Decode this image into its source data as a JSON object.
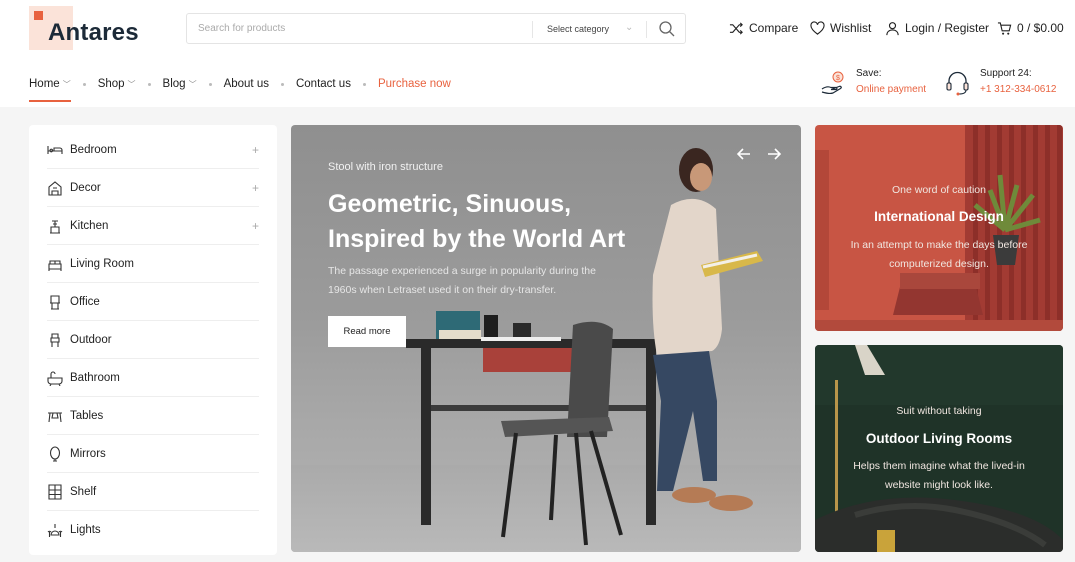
{
  "brand": {
    "name": "Antares",
    "accent": "#e8623f"
  },
  "search": {
    "placeholder": "Search for products",
    "category": "Select category"
  },
  "header_actions": {
    "compare": "Compare",
    "wishlist": "Wishlist",
    "login": "Login / Register",
    "cart": "0 / $0.00"
  },
  "nav": {
    "home": "Home",
    "shop": "Shop",
    "blog": "Blog",
    "about": "About us",
    "contact": "Contact us",
    "purchase": "Purchase now"
  },
  "info": {
    "save_label": "Save:",
    "save_value": "Online payment",
    "support_label": "Support 24:",
    "support_value": "+1 312-334-0612"
  },
  "sidebar": {
    "items": [
      {
        "label": "Bedroom",
        "icon": "bed-icon",
        "expandable": true
      },
      {
        "label": "Decor",
        "icon": "decor-icon",
        "expandable": true
      },
      {
        "label": "Kitchen",
        "icon": "kitchen-icon",
        "expandable": true
      },
      {
        "label": "Living Room",
        "icon": "sofa-icon",
        "expandable": false
      },
      {
        "label": "Office",
        "icon": "office-icon",
        "expandable": false
      },
      {
        "label": "Outdoor",
        "icon": "outdoor-icon",
        "expandable": false
      },
      {
        "label": "Bathroom",
        "icon": "bathtub-icon",
        "expandable": false
      },
      {
        "label": "Tables",
        "icon": "table-icon",
        "expandable": false
      },
      {
        "label": "Mirrors",
        "icon": "mirror-icon",
        "expandable": false
      },
      {
        "label": "Shelf",
        "icon": "shelf-icon",
        "expandable": false
      },
      {
        "label": "Lights",
        "icon": "lamp-icon",
        "expandable": false
      }
    ]
  },
  "hero": {
    "kicker": "Stool with iron structure",
    "title_line1": "Geometric, Sinuous,",
    "title_line2": "Inspired by the World Art",
    "text_line1": "The passage experienced a surge in popularity during the",
    "text_line2": "1960s when Letraset used it on their dry-transfer.",
    "button": "Read more"
  },
  "promo1": {
    "kicker": "One word of caution",
    "title": "International Design",
    "text_line1": "In an attempt to make the days before",
    "text_line2": "computerized design."
  },
  "promo2": {
    "kicker": "Suit without taking",
    "title": "Outdoor Living Rooms",
    "text_line1": "Helps them imagine what the lived-in",
    "text_line2": "website might look like."
  }
}
